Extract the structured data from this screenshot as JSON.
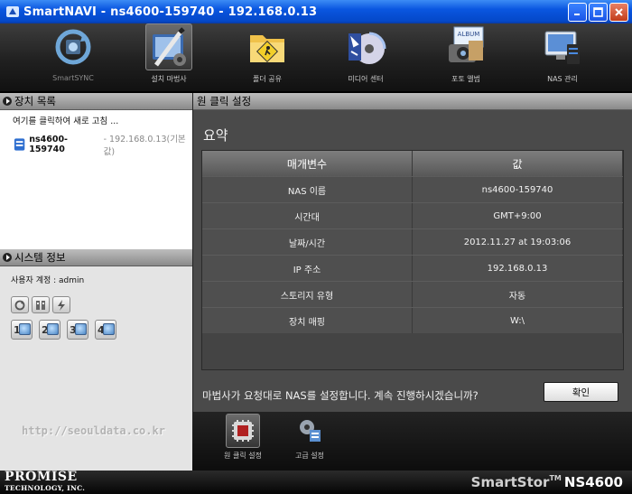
{
  "window": {
    "title": "SmartNAVI - ns4600-159740 - 192.168.0.13"
  },
  "toolbar": {
    "items": [
      {
        "label": "SmartSYNC",
        "icon": "smartsync-icon",
        "active": false
      },
      {
        "label": "설치 마법사",
        "icon": "setup-wizard-icon",
        "active": true
      },
      {
        "label": "폴더 공유",
        "icon": "folder-share-icon",
        "active": false
      },
      {
        "label": "미디어 센터",
        "icon": "media-center-icon",
        "active": false
      },
      {
        "label": "포토 앨범",
        "icon": "photo-album-icon",
        "active": false
      },
      {
        "label": "NAS 관리",
        "icon": "nas-manage-icon",
        "active": false
      }
    ],
    "photo_album_sign": "ALBUM"
  },
  "device_list": {
    "header": "장치 목록",
    "refresh_text": "여기를 클릭하여 새로 고침 ...",
    "device_name": "ns4600-159740",
    "device_addr": "- 192.168.0.13(기본값)"
  },
  "system_info": {
    "header": "시스템 정보",
    "user_account": "사용자 계정 : admin",
    "volumes": [
      "1",
      "2",
      "3",
      "4"
    ]
  },
  "main": {
    "header": "원 클릭 설정",
    "summary_title": "요약",
    "table": {
      "headers": [
        "매개변수",
        "값"
      ],
      "rows": [
        [
          "NAS 이름",
          "ns4600-159740"
        ],
        [
          "시간대",
          "GMT+9:00"
        ],
        [
          "날짜/시간",
          "2012.11.27 at 19:03:06"
        ],
        [
          "IP 주소",
          "192.168.0.13"
        ],
        [
          "스토리지 유형",
          "자동"
        ],
        [
          "장치 매핑",
          "W:\\"
        ]
      ]
    },
    "confirm_text": "마법사가 요청대로 NAS를 설정합니다. 계속 진행하시겠습니까?",
    "ok_label": "확인"
  },
  "bottom_tools": [
    {
      "label": "원 클릭 설정",
      "icon": "one-click-setup-icon",
      "active": true
    },
    {
      "label": "고급 설정",
      "icon": "advanced-setup-icon",
      "active": false
    }
  ],
  "watermark": "http://seouldata.co.kr",
  "footer": {
    "brand_line1": "PROMISE",
    "brand_line2": "TECHNOLOGY, INC.",
    "product": "SmartStor",
    "trademark": "TM",
    "model": "NS4600"
  },
  "colors": {
    "titlebar": "#0a56e0",
    "panel_dark": "#4a4a4a",
    "header_gray": "#a5a5a5"
  }
}
